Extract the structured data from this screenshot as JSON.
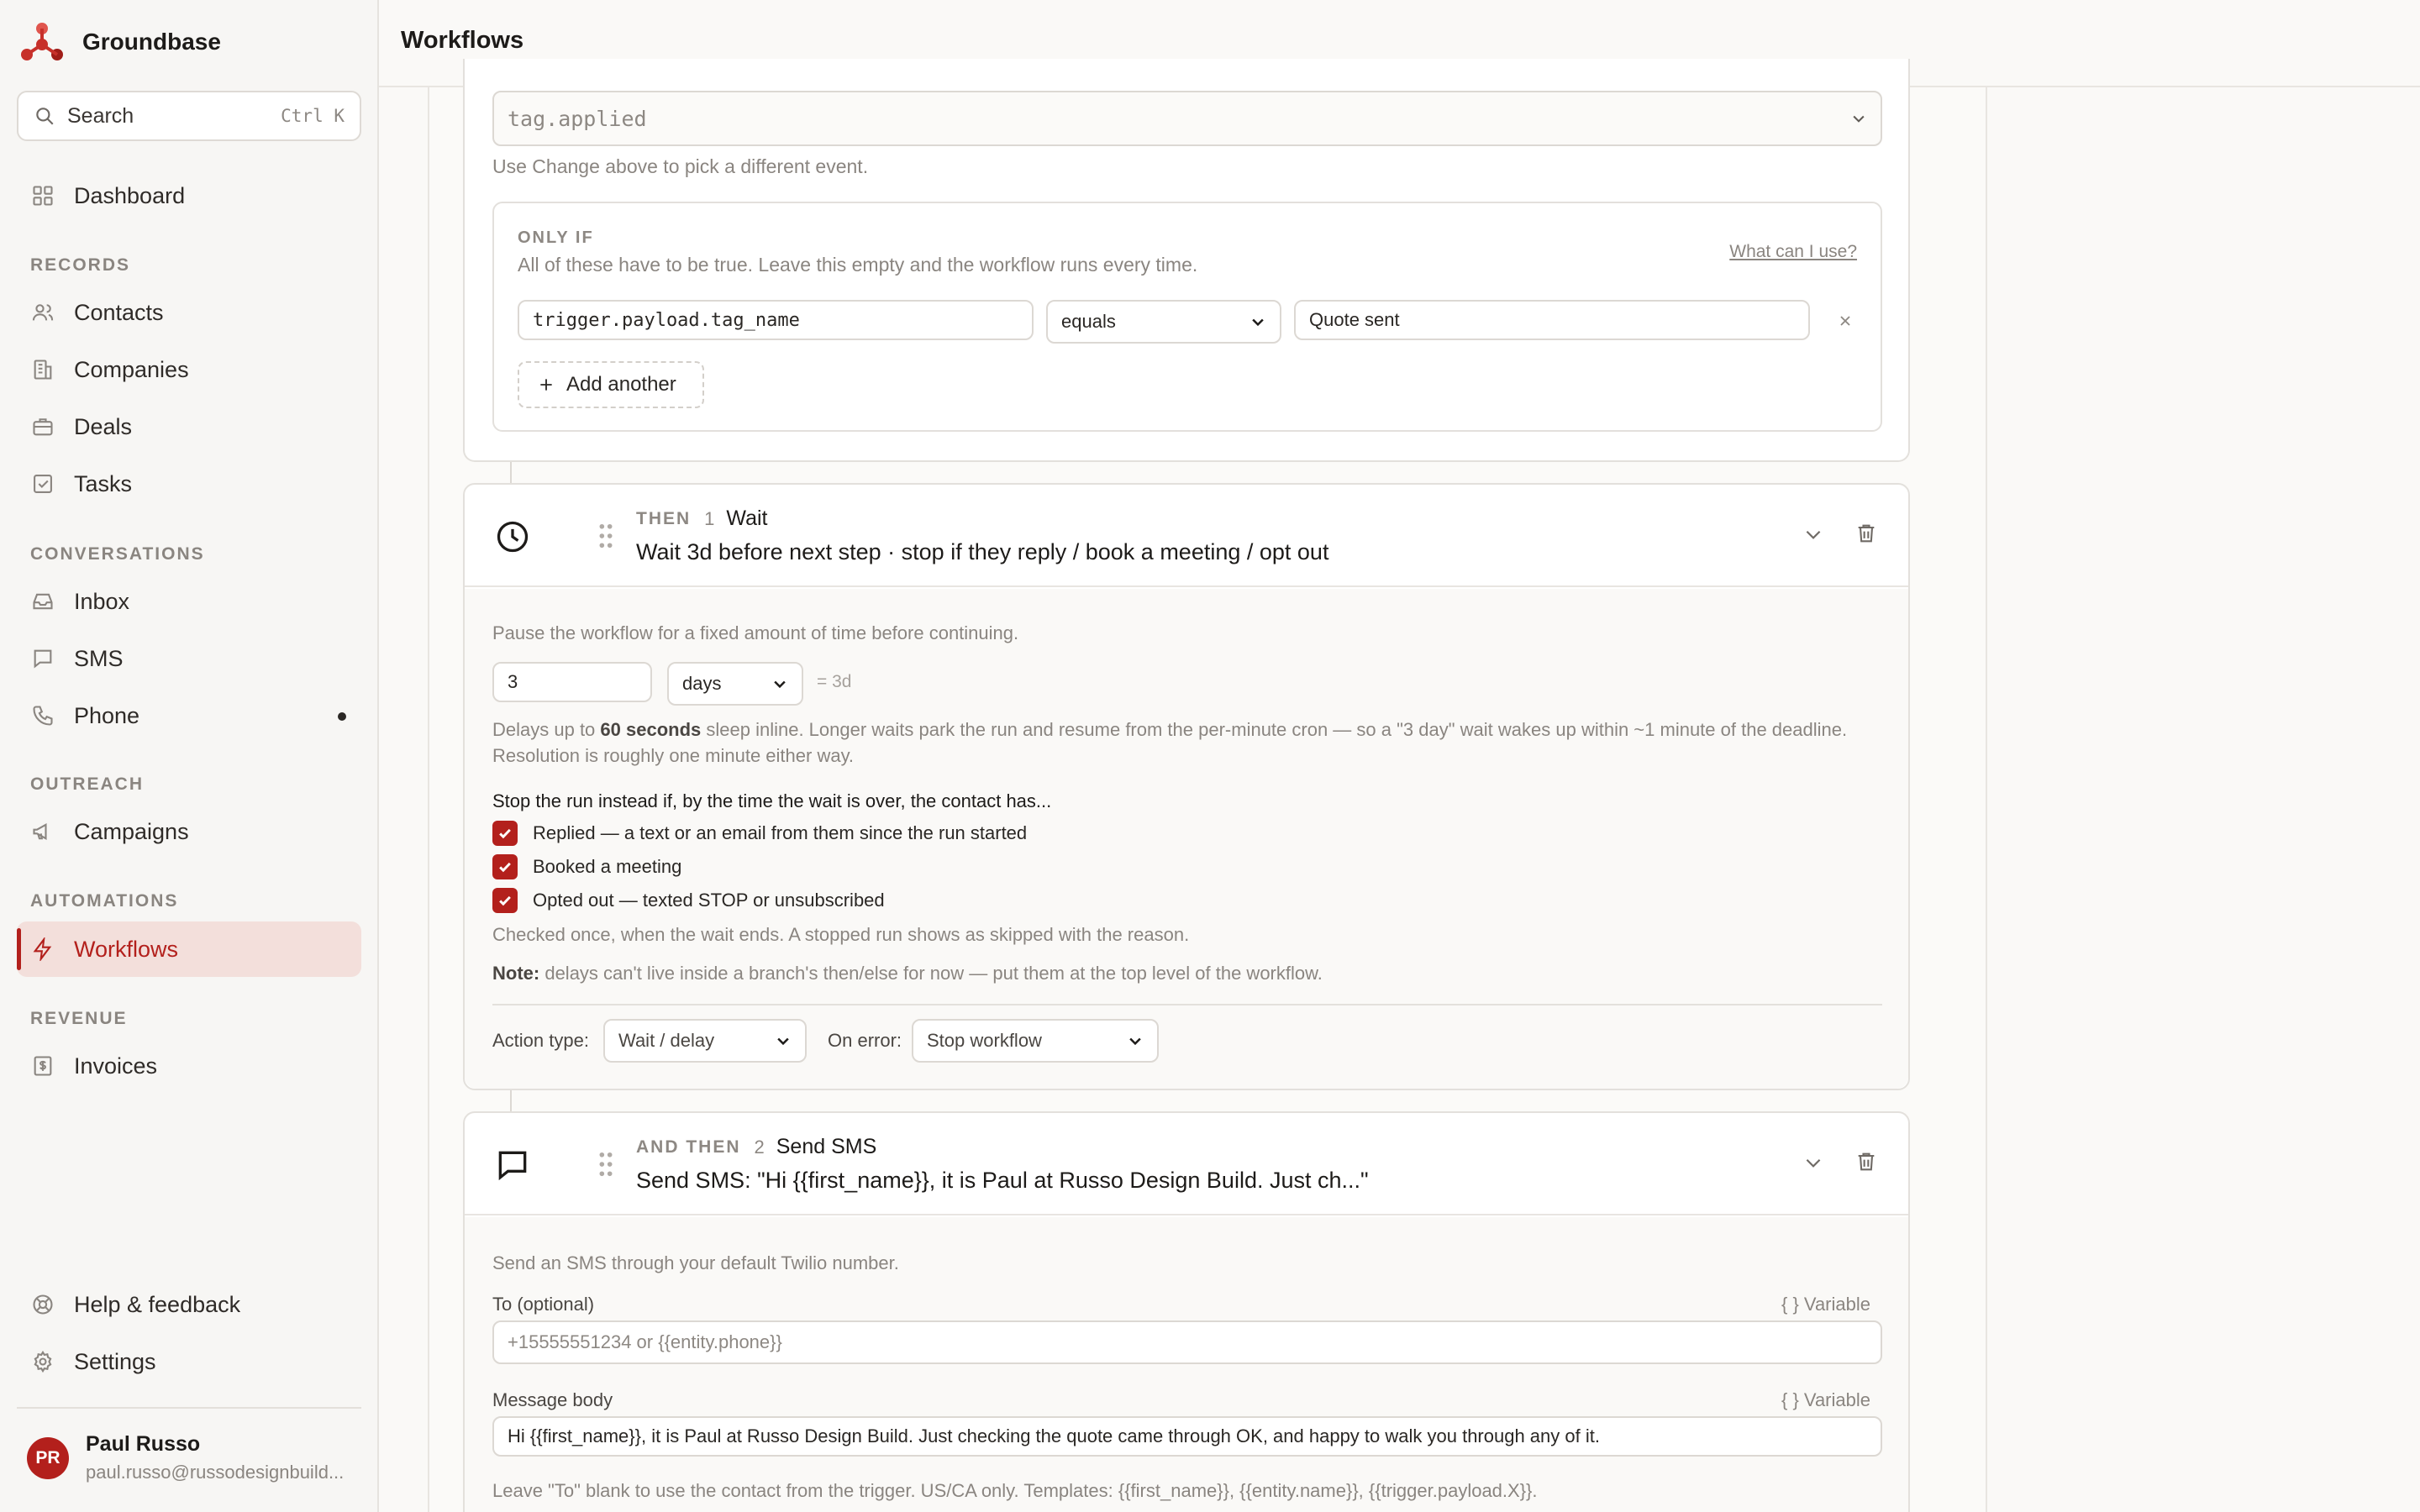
{
  "app": {
    "name": "Groundbase",
    "page_title": "Workflows"
  },
  "search": {
    "placeholder": "Search",
    "shortcut": "Ctrl K"
  },
  "sidebar": {
    "dashboard": "Dashboard",
    "sections": {
      "records": "RECORDS",
      "conversations": "CONVERSATIONS",
      "outreach": "OUTREACH",
      "automations": "AUTOMATIONS",
      "revenue": "REVENUE"
    },
    "records": [
      "Contacts",
      "Companies",
      "Deals",
      "Tasks"
    ],
    "conversations": [
      "Inbox",
      "SMS",
      "Phone"
    ],
    "outreach": [
      "Campaigns"
    ],
    "automations": [
      "Workflows"
    ],
    "revenue": [
      "Invoices"
    ],
    "footer": [
      "Help & feedback",
      "Settings"
    ],
    "active": "Workflows",
    "phone_has_unread": true
  },
  "user": {
    "initials": "PR",
    "name": "Paul Russo",
    "email": "paul.russo@russodesignbuild..."
  },
  "trigger": {
    "event": "tag.applied",
    "event_hint": "Use Change above to pick a different event.",
    "only_if_label": "ONLY IF",
    "only_if_desc": "All of these have to be true. Leave this empty and the workflow runs every time.",
    "help_link": "What can I use?",
    "condition": {
      "field": "trigger.payload.tag_name",
      "operator": "equals",
      "value": "Quote sent"
    },
    "add_another": "Add another"
  },
  "step1": {
    "prefix": "THEN",
    "number": "1",
    "name": "Wait",
    "summary": "Wait 3d before next step · stop if they reply / book a meeting / opt out",
    "description": "Pause the workflow for a fixed amount of time before continuing.",
    "amount": "3",
    "unit": "days",
    "computed": "= 3d",
    "note_line1_a": "Delays up to ",
    "note_line1_bold": "60 seconds",
    "note_line1_b": " sleep inline. Longer waits park the run and resume from the per-minute cron — so a \"3 day\" wait wakes up within ~1 minute of the deadline.",
    "note_line2": "Resolution is roughly one minute either way.",
    "stop_heading": "Stop the run instead if, by the time the wait is over, the contact has...",
    "stop_options": [
      {
        "label": "Replied — a text or an email from them since the run started",
        "checked": true
      },
      {
        "label": "Booked a meeting",
        "checked": true
      },
      {
        "label": "Opted out — texted STOP or unsubscribed",
        "checked": true
      }
    ],
    "checked_note": "Checked once, when the wait ends. A stopped run shows as skipped with the reason.",
    "note_label": "Note:",
    "note_text": " delays can't live inside a branch's then/else for now — put them at the top level of the workflow.",
    "action_type_label": "Action type:",
    "action_type": "Wait / delay",
    "on_error_label": "On error:",
    "on_error": "Stop workflow"
  },
  "step2": {
    "prefix": "AND THEN",
    "number": "2",
    "name": "Send SMS",
    "summary": "Send SMS: \"Hi {{first_name}}, it is Paul at Russo Design Build. Just ch...\"",
    "description": "Send an SMS through your default Twilio number.",
    "to_label": "To (optional)",
    "variable_label": "{ } Variable",
    "to_placeholder": "+15555551234 or {{entity.phone}}",
    "body_label": "Message body",
    "body_value": "Hi {{first_name}}, it is Paul at Russo Design Build. Just checking the quote came through OK, and happy to walk you through any of it.",
    "footer_note": "Leave \"To\" blank to use the contact from the trigger. US/CA only. Templates: {{first_name}}, {{entity.name}}, {{trigger.payload.X}}."
  },
  "colors": {
    "accent": "#b3201c",
    "active_bg": "#f3dfdb",
    "border": "#e3e0dc",
    "muted_text": "#8a8580"
  }
}
